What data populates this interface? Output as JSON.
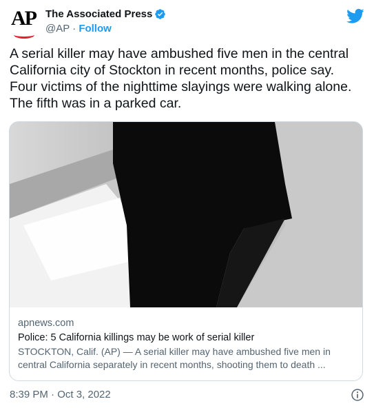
{
  "author": {
    "display_name": "The Associated Press",
    "handle": "@AP",
    "separator": "·",
    "follow_label": "Follow",
    "avatar_text": "AP",
    "avatar_accent": "#e5202e"
  },
  "tweet": {
    "text": "A serial killer may have ambushed five men in the central California city of Stockton in recent months, police say. Four victims of the nighttime slayings were walking alone. The fifth was in a parked car.",
    "timestamp": "8:39 PM · Oct 3, 2022"
  },
  "card": {
    "domain": "apnews.com",
    "title": "Police: 5 California killings may be work of serial killer",
    "description": "STOCKTON, Calif. (AP) — A serial killer may have ambushed five men in central California separately in recent months, shooting them to death ..."
  },
  "icons": {
    "verified": "verified-badge-icon",
    "brand": "twitter-bird-icon",
    "info": "info-icon"
  },
  "colors": {
    "link": "#1d9bf0",
    "secondary_text": "#536471",
    "primary_text": "#0f1419",
    "border": "#cfd9de"
  }
}
